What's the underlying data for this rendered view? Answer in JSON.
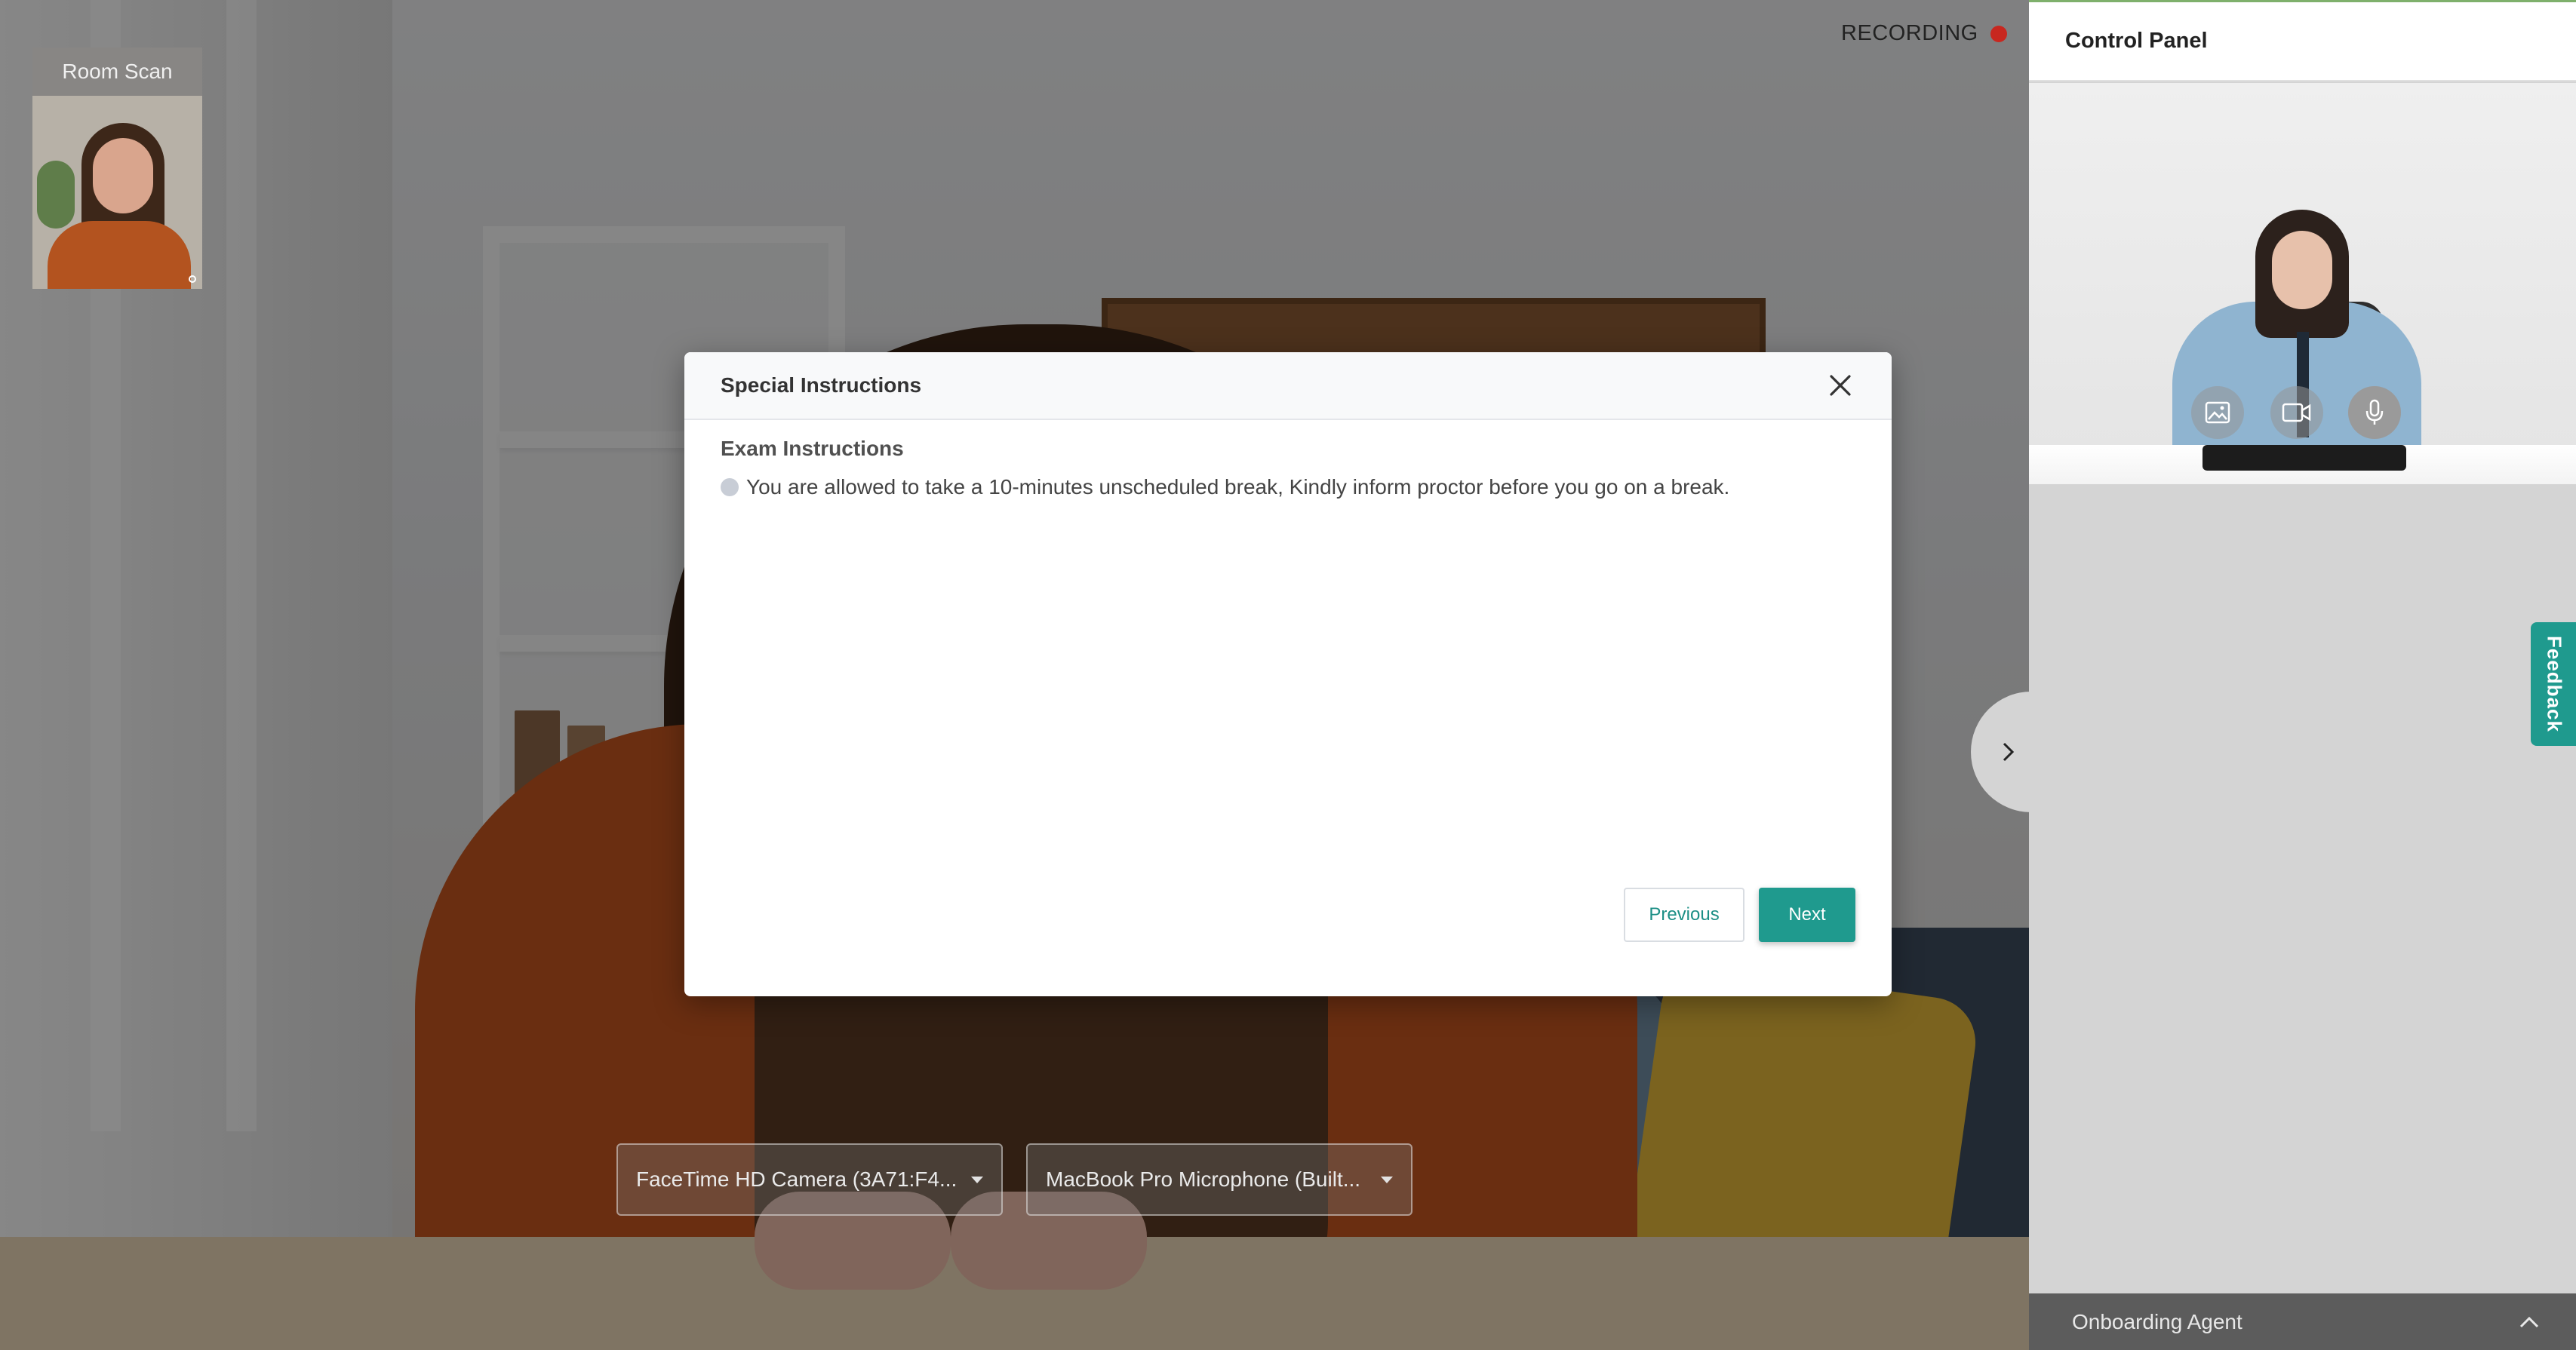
{
  "recording": {
    "label": "RECORDING",
    "dot_color": "#c8271f"
  },
  "room_scan": {
    "label": "Room Scan"
  },
  "modal": {
    "title": "Special Instructions",
    "section_title": "Exam Instructions",
    "items": [
      "You are allowed to take a 10-minutes unscheduled break, Kindly inform proctor before you go on a break."
    ],
    "previous_label": "Previous",
    "next_label": "Next",
    "close_icon": "close-icon"
  },
  "devices": {
    "camera": "FaceTime HD Camera (3A71:F4...",
    "microphone": "MacBook Pro Microphone (Built..."
  },
  "control_panel": {
    "title": "Control Panel",
    "media_buttons": [
      "image-icon",
      "video-camera-icon",
      "microphone-icon"
    ]
  },
  "feedback": {
    "label": "Feedback"
  },
  "onboarding": {
    "label": "Onboarding Agent"
  },
  "colors": {
    "accent": "#1f9a8e",
    "recording": "#c8271f",
    "panel_bg": "#d4d4d4"
  }
}
